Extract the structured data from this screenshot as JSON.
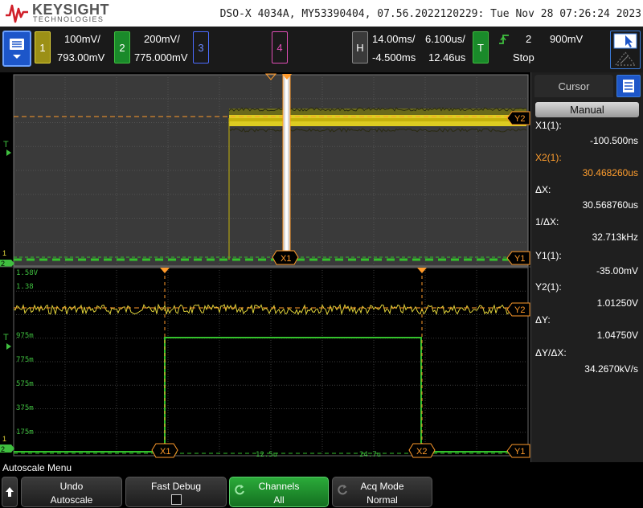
{
  "header": {
    "brand": "KEYSIGHT",
    "brand_sub": "TECHNOLOGIES",
    "title": "DSO-X 4034A, MY53390404, 07.56.2022120229: Tue Nov 28 07:26:24 2023"
  },
  "status": {
    "ch1": {
      "num": "1",
      "scale": "100mV/",
      "offset": "793.00mV",
      "color": "#e0d33a"
    },
    "ch2": {
      "num": "2",
      "scale": "200mV/",
      "offset": "775.000mV",
      "color": "#3fbf3f"
    },
    "ch3": {
      "num": "3",
      "color": "#4c6cff"
    },
    "ch4": {
      "num": "4",
      "color": "#e04eb6"
    },
    "horizontal": {
      "label": "H",
      "scale": "14.00ms/",
      "delay": "-4.500ms",
      "zoom_scale": "6.100us/",
      "zoom_delay": "12.46us"
    },
    "trigger": {
      "label": "T",
      "source": "2",
      "level": "900mV",
      "state": "Stop",
      "color": "#3fbf3f"
    }
  },
  "panel": {
    "tab": "Cursor",
    "mode": "Manual",
    "rows": [
      {
        "label": "X1(1):",
        "value": "-100.500ns",
        "highlight": false
      },
      {
        "label": "X2(1):",
        "value": "30.468260us",
        "highlight": true
      },
      {
        "label": "ΔX:",
        "value": "30.568760us",
        "highlight": false
      },
      {
        "label": "1/ΔX:",
        "value": "32.713kHz",
        "highlight": false
      },
      {
        "label": "Y1(1):",
        "value": "-35.00mV",
        "highlight": false
      },
      {
        "label": "Y2(1):",
        "value": "1.01250V",
        "highlight": false
      },
      {
        "label": "ΔY:",
        "value": "1.04750V",
        "highlight": false
      },
      {
        "label": "ΔY/ΔX:",
        "value": "34.2670kV/s",
        "highlight": false
      }
    ]
  },
  "zoom_axis": {
    "y_labels": [
      "1.58V",
      "1.38",
      "975m",
      "775m",
      "575m",
      "375m",
      "175m"
    ],
    "x_labels": [
      "12.5u",
      "24.7u"
    ]
  },
  "cursor_markers": {
    "x1": "X1",
    "x2": "X2",
    "y1": "Y1",
    "y2": "Y2"
  },
  "softkeys": {
    "menu_title": "Autoscale Menu",
    "undo": {
      "l1": "Undo",
      "l2": "Autoscale"
    },
    "fast_debug": {
      "l1": "Fast Debug"
    },
    "channels": {
      "l1": "Channels",
      "l2": "All"
    },
    "acq_mode": {
      "l1": "Acq Mode",
      "l2": "Normal"
    }
  }
}
